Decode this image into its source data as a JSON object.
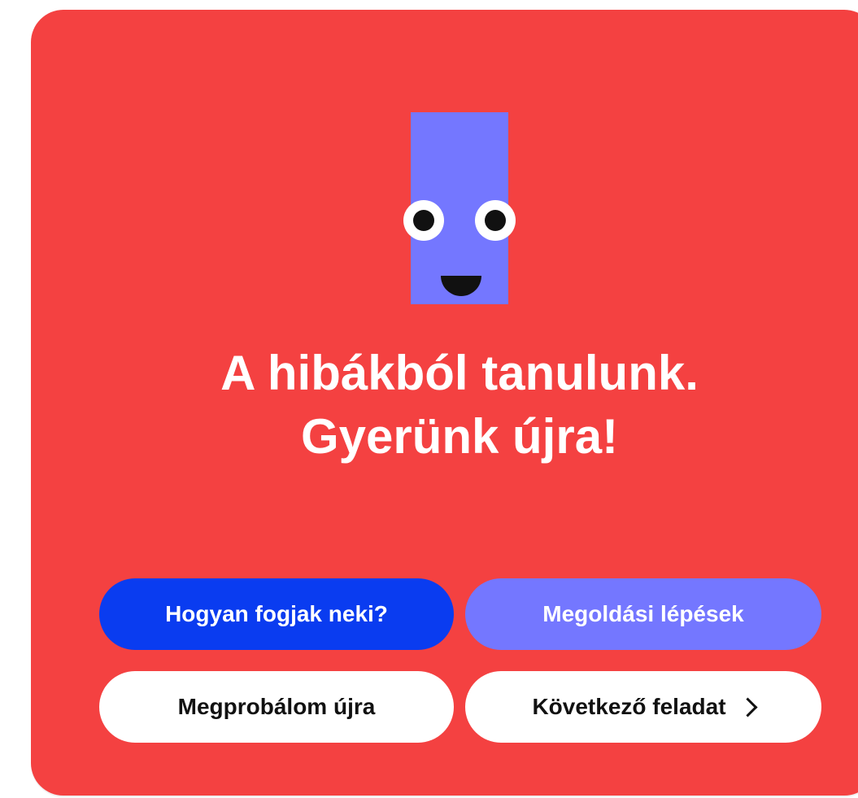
{
  "feedback": {
    "headline_line1": "A hibákból tanulunk.",
    "headline_line2": "Gyerünk újra!",
    "mascot_icon": "smiling-rectangle-mascot",
    "colors": {
      "card_background": "#f44141",
      "mascot": "#7477ff",
      "primary_button": "#0a3cf0",
      "secondary_button": "#7477ff",
      "neutral_button": "#ffffff"
    }
  },
  "actions": {
    "how_to_label": "Hogyan fogjak neki?",
    "solution_steps_label": "Megoldási lépések",
    "retry_label": "Megprobálom újra",
    "next_task_label": "Következő feladat",
    "next_icon": "chevron-right-icon"
  }
}
